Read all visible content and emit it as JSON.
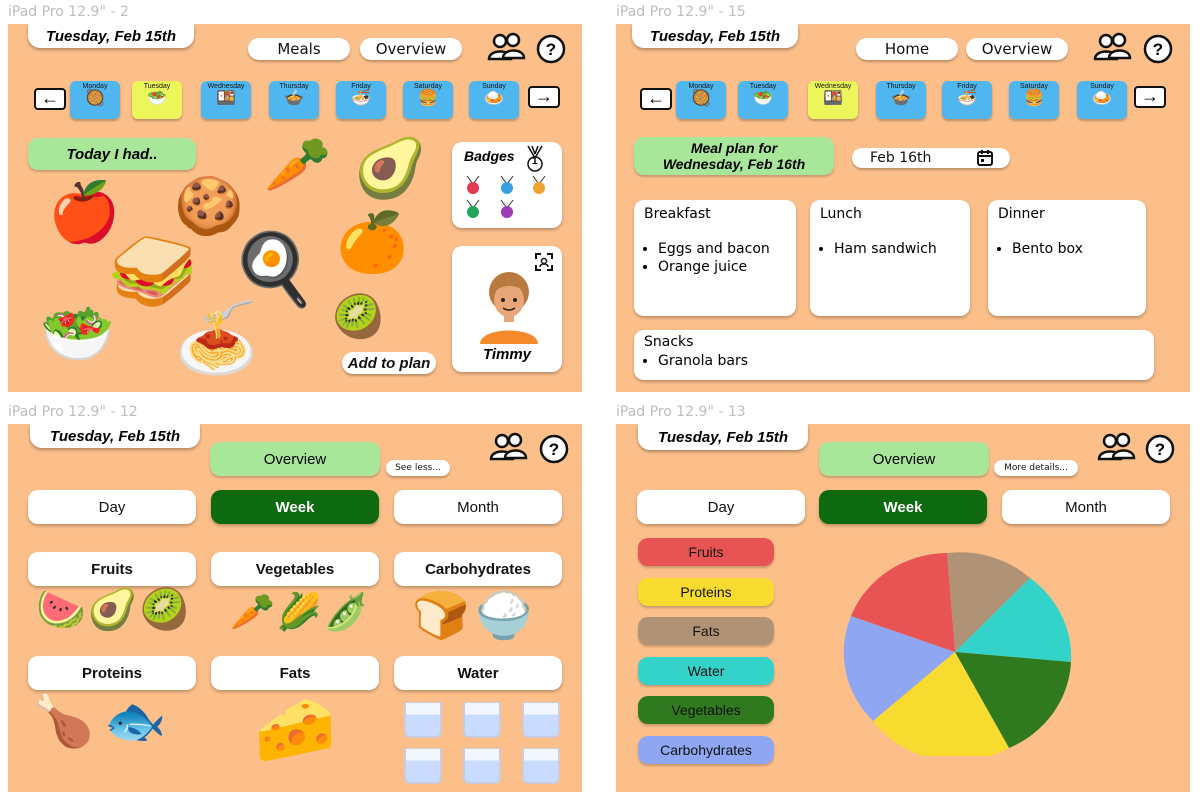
{
  "frames": {
    "f1": {
      "label": "iPad Pro 12.9\" - 2",
      "date": "Tuesday, Feb 15th",
      "nav": {
        "meals": "Meals",
        "overview": "Overview"
      },
      "days": [
        {
          "name": "Monday",
          "food": "🥘"
        },
        {
          "name": "Tuesday",
          "food": "🥗"
        },
        {
          "name": "Wednesday",
          "food": "🍱"
        },
        {
          "name": "Thursday",
          "food": "🍲"
        },
        {
          "name": "Friday",
          "food": "🍜"
        },
        {
          "name": "Saturday",
          "food": "🍔"
        },
        {
          "name": "Sunday",
          "food": "🍛"
        }
      ],
      "today_label": "Today I had..",
      "foods": [
        "🍎",
        "🍪",
        "🥕",
        "🥑",
        "🥪",
        "🍳",
        "🍊",
        "🥗",
        "🍝",
        "🥝"
      ],
      "add_to_plan": "Add to plan",
      "badges_title": "Badges",
      "badge_count": "1",
      "profile_name": "Timmy"
    },
    "f2": {
      "label": "iPad Pro 12.9\" - 15",
      "date": "Tuesday, Feb 15th",
      "nav": {
        "home": "Home",
        "overview": "Overview"
      },
      "days": [
        {
          "name": "Monday",
          "food": "🥘"
        },
        {
          "name": "Tuesday",
          "food": "🥗"
        },
        {
          "name": "Wednesday",
          "food": "🍱"
        },
        {
          "name": "Thursday",
          "food": "🍲"
        },
        {
          "name": "Friday",
          "food": "🍜"
        },
        {
          "name": "Saturday",
          "food": "🍔"
        },
        {
          "name": "Sunday",
          "food": "🍛"
        }
      ],
      "plan_title": "Meal plan for Wednesday, Feb 16th",
      "date_input": "Feb 16th",
      "breakfast": {
        "title": "Breakfast",
        "items": [
          "Eggs and bacon",
          "Orange juice"
        ]
      },
      "lunch": {
        "title": "Lunch",
        "items": [
          "Ham sandwich"
        ]
      },
      "dinner": {
        "title": "Dinner",
        "items": [
          "Bento box"
        ]
      },
      "snacks": {
        "title": "Snacks",
        "items": [
          "Granola bars"
        ]
      }
    },
    "f3": {
      "label": "iPad Pro 12.9\" - 12",
      "date": "Tuesday, Feb 15th",
      "overview": "Overview",
      "see_less": "See less...",
      "tabs": [
        "Day",
        "Week",
        "Month"
      ],
      "categories": [
        "Fruits",
        "Vegetables",
        "Carbohydrates",
        "Proteins",
        "Fats",
        "Water"
      ],
      "cat_foods": {
        "fruits": "🍉🥑🥝",
        "vegetables": "🥕🌽🫛",
        "carbs": "🍞🍚",
        "proteins": "🍗🐟",
        "fats": "🧀"
      }
    },
    "f4": {
      "label": "iPad Pro 12.9\" - 13",
      "date": "Tuesday, Feb 15th",
      "overview": "Overview",
      "more_details": "More details...",
      "tabs": [
        "Day",
        "Week",
        "Month"
      ],
      "legend": [
        "Fruits",
        "Proteins",
        "Fats",
        "Water",
        "Vegetables",
        "Carbohydrates"
      ],
      "legend_colors": [
        "#e85353",
        "#f7dc2f",
        "#b09377",
        "#33d3c9",
        "#2f7a1e",
        "#8fa7f2"
      ]
    }
  }
}
